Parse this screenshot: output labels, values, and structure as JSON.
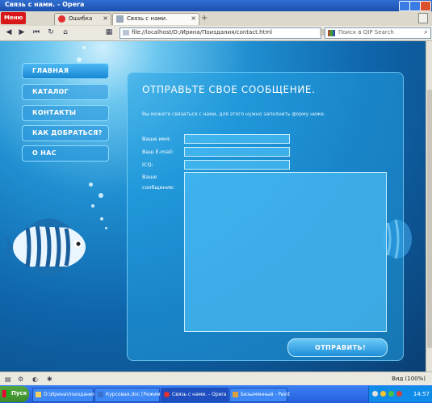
{
  "window": {
    "title": "Связь с нами. - Opera"
  },
  "browser": {
    "menu_label": "Меню",
    "tabs": [
      {
        "label": "Ошибка",
        "active": false
      },
      {
        "label": "Связь с нами.",
        "active": true
      }
    ],
    "address": "file://localhost/D:/Ирина/Поиздания/contact.html",
    "search_placeholder": "Поиск в QIP Search",
    "zoom": "Вид (100%)"
  },
  "site": {
    "nav": [
      {
        "label": "ГЛАВНАЯ",
        "active": true
      },
      {
        "label": "КАТАЛОГ",
        "active": false
      },
      {
        "label": "КОНТАКТЫ",
        "active": false
      },
      {
        "label": "КАК ДОБРАТЬСЯ?",
        "active": false
      },
      {
        "label": "О НАС",
        "active": false
      }
    ],
    "form": {
      "title": "ОТПРАВЬТЕ СВОЕ СООБЩЕНИЕ.",
      "intro": "Вы можете связаться с нами, для этого нужно заполнить форму ниже.",
      "fields": {
        "name_label": "Ваше имя:",
        "email_label": "Ваш E-mail:",
        "icq_label": "ICQ:",
        "message_label_1": "Ваше",
        "message_label_2": "сообщение:"
      },
      "submit": "ОТПРАВИТЬ!"
    }
  },
  "taskbar": {
    "start": "Пуск",
    "tasks": [
      {
        "label": "D:\\Ирина\\поиздания",
        "active": false
      },
      {
        "label": "Курсовая.doc [Режим с...",
        "active": false
      },
      {
        "label": "Связь с нами. - Opera",
        "active": true
      },
      {
        "label": "Безымянный - Paint",
        "active": false
      }
    ],
    "time": "14:57"
  },
  "colors": {
    "accent": "#1f8fd1",
    "brand_menu": "#d81818",
    "taskbar": "#245edb"
  }
}
